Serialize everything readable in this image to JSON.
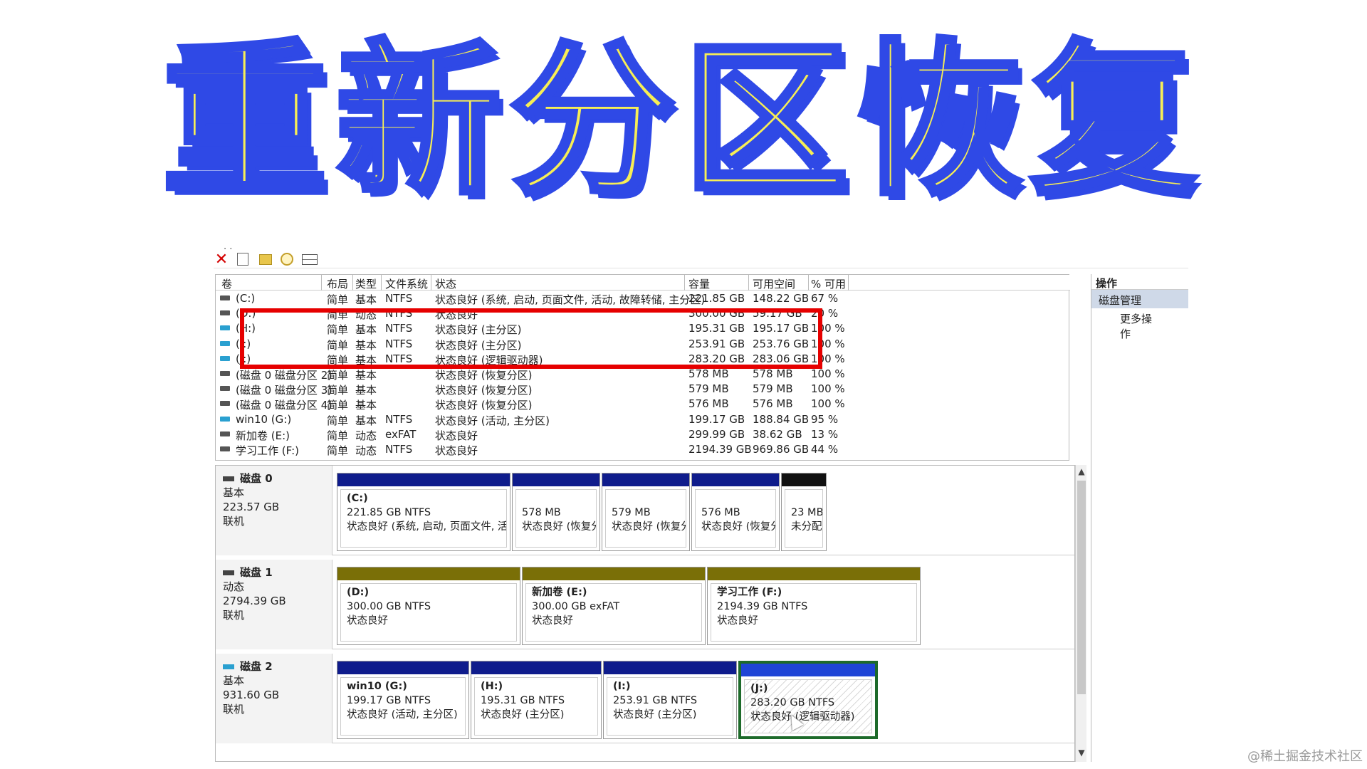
{
  "banner": {
    "title": "重新分区恢复"
  },
  "toolbar": {
    "icons": [
      "delete-icon",
      "properties-icon",
      "folder-up-icon",
      "search-icon",
      "view-icon"
    ]
  },
  "columns": {
    "vol": "卷",
    "layout": "布局",
    "type": "类型",
    "fs": "文件系统",
    "status": "状态",
    "capacity": "容量",
    "free": "可用空间",
    "pct": "% 可用"
  },
  "volumes": [
    {
      "name": "(C:)",
      "layout": "简单",
      "type": "基本",
      "fs": "NTFS",
      "status": "状态良好 (系统, 启动, 页面文件, 活动, 故障转储, 主分区)",
      "capacity": "221.85 GB",
      "free": "148.22 GB",
      "pct": "67 %"
    },
    {
      "name": "(D:)",
      "layout": "简单",
      "type": "动态",
      "fs": "NTFS",
      "status": "状态良好",
      "capacity": "300.00 GB",
      "free": "59.17 GB",
      "pct": "20 %"
    },
    {
      "name": "(H:)",
      "layout": "简单",
      "type": "基本",
      "fs": "NTFS",
      "status": "状态良好 (主分区)",
      "capacity": "195.31 GB",
      "free": "195.17 GB",
      "pct": "100 %"
    },
    {
      "name": "(I:)",
      "layout": "简单",
      "type": "基本",
      "fs": "NTFS",
      "status": "状态良好 (主分区)",
      "capacity": "253.91 GB",
      "free": "253.76 GB",
      "pct": "100 %"
    },
    {
      "name": "(J:)",
      "layout": "简单",
      "type": "基本",
      "fs": "NTFS",
      "status": "状态良好 (逻辑驱动器)",
      "capacity": "283.20 GB",
      "free": "283.06 GB",
      "pct": "100 %"
    },
    {
      "name": "(磁盘 0 磁盘分区 2)",
      "layout": "简单",
      "type": "基本",
      "fs": "",
      "status": "状态良好 (恢复分区)",
      "capacity": "578 MB",
      "free": "578 MB",
      "pct": "100 %"
    },
    {
      "name": "(磁盘 0 磁盘分区 3)",
      "layout": "简单",
      "type": "基本",
      "fs": "",
      "status": "状态良好 (恢复分区)",
      "capacity": "579 MB",
      "free": "579 MB",
      "pct": "100 %"
    },
    {
      "name": "(磁盘 0 磁盘分区 4)",
      "layout": "简单",
      "type": "基本",
      "fs": "",
      "status": "状态良好 (恢复分区)",
      "capacity": "576 MB",
      "free": "576 MB",
      "pct": "100 %"
    },
    {
      "name": "win10 (G:)",
      "layout": "简单",
      "type": "基本",
      "fs": "NTFS",
      "status": "状态良好 (活动, 主分区)",
      "capacity": "199.17 GB",
      "free": "188.84 GB",
      "pct": "95 %"
    },
    {
      "name": "新加卷 (E:)",
      "layout": "简单",
      "type": "动态",
      "fs": "exFAT",
      "status": "状态良好",
      "capacity": "299.99 GB",
      "free": "38.62 GB",
      "pct": "13 %"
    },
    {
      "name": "学习工作 (F:)",
      "layout": "简单",
      "type": "动态",
      "fs": "NTFS",
      "status": "状态良好",
      "capacity": "2194.39 GB",
      "free": "969.86 GB",
      "pct": "44 %"
    }
  ],
  "disks": [
    {
      "title": "磁盘 0",
      "type": "基本",
      "size": "223.57 GB",
      "state": "联机",
      "partitions": [
        {
          "name": "(C:)",
          "size": "221.85 GB NTFS",
          "status": "状态良好 (系统, 启动, 页面文件, 活动"
        },
        {
          "name": "",
          "size": "578 MB",
          "status": "状态良好 (恢复分"
        },
        {
          "name": "",
          "size": "579 MB",
          "status": "状态良好 (恢复分"
        },
        {
          "name": "",
          "size": "576 MB",
          "status": "状态良好 (恢复分"
        },
        {
          "name": "",
          "size": "23 MB",
          "status": "未分配"
        }
      ]
    },
    {
      "title": "磁盘 1",
      "type": "动态",
      "size": "2794.39 GB",
      "state": "联机",
      "partitions": [
        {
          "name": "(D:)",
          "size": "300.00 GB NTFS",
          "status": "状态良好"
        },
        {
          "name": "新加卷  (E:)",
          "size": "300.00 GB exFAT",
          "status": "状态良好"
        },
        {
          "name": "学习工作  (F:)",
          "size": "2194.39 GB NTFS",
          "status": "状态良好"
        }
      ]
    },
    {
      "title": "磁盘 2",
      "type": "基本",
      "size": "931.60 GB",
      "state": "联机",
      "partitions": [
        {
          "name": "win10  (G:)",
          "size": "199.17 GB NTFS",
          "status": "状态良好 (活动, 主分区)"
        },
        {
          "name": "(H:)",
          "size": "195.31 GB NTFS",
          "status": "状态良好 (主分区)"
        },
        {
          "name": "(I:)",
          "size": "253.91 GB NTFS",
          "status": "状态良好 (主分区)"
        },
        {
          "name": "(J:)",
          "size": "283.20 GB NTFS",
          "status": "状态良好 (逻辑驱动器)"
        }
      ]
    }
  ],
  "actions": {
    "header": "操作",
    "section": "磁盘管理",
    "more": "更多操作"
  },
  "watermark": "@稀土掘金技术社区",
  "colors": {
    "banner_fill": "#f7ee55",
    "banner_stroke": "#2f49e6",
    "highlight": "#e60000",
    "primary_bar": "#0f1c8c",
    "dynamic_bar": "#7a6f07",
    "logical_bar": "#1e44d6",
    "unallocated_bar": "#111111"
  }
}
